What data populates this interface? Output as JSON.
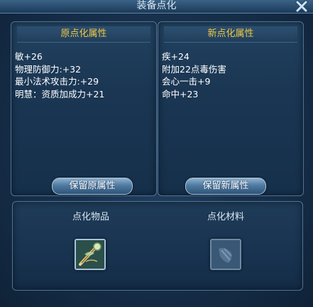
{
  "window": {
    "title": "装备点化"
  },
  "original_panel": {
    "header": "原点化属性",
    "attributes": [
      "敏+26",
      "物理防御力:+32",
      "最小法术攻击力:+29",
      "明慧：资质加成力+21"
    ],
    "keep_button": "保留原属性"
  },
  "new_panel": {
    "header": "新点化属性",
    "attributes": [
      "疾+24",
      "附加22点毒伤害",
      "会心一击+9",
      "命中+23"
    ],
    "keep_button": "保留新属性"
  },
  "bottom": {
    "item_label": "点化物品",
    "material_label": "点化材料"
  },
  "icons": {
    "close": "close-icon",
    "item": "staff-item-icon",
    "material": "material-placeholder-icon"
  },
  "colors": {
    "header_text": "#f2c840",
    "attr_text": "#ffffff",
    "panel_border": "#4d7497"
  }
}
